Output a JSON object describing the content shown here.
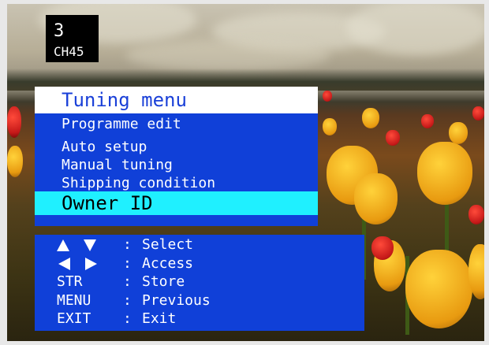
{
  "channel": {
    "number": "3",
    "name": "CH45"
  },
  "menu": {
    "title": "Tuning menu",
    "items": [
      {
        "label": "Programme edit"
      },
      {
        "label": "Auto setup"
      },
      {
        "label": "Manual tuning"
      },
      {
        "label": "Shipping condition"
      },
      {
        "label": "Owner ID"
      }
    ],
    "selected_index": 4
  },
  "help": {
    "colon": ":",
    "rows": [
      {
        "key": "up-down-icons",
        "desc": "Select"
      },
      {
        "key": "left-right-icons",
        "desc": "Access"
      },
      {
        "key": "STR",
        "desc": "Store"
      },
      {
        "key": "MENU",
        "desc": "Previous"
      },
      {
        "key": "EXIT",
        "desc": "Exit"
      }
    ]
  },
  "colors": {
    "menu_bg": "#1040d8",
    "title_bg": "#ffffff",
    "title_text": "#1a40d8",
    "highlight": "#1ff0ff",
    "text": "#ffffff"
  }
}
